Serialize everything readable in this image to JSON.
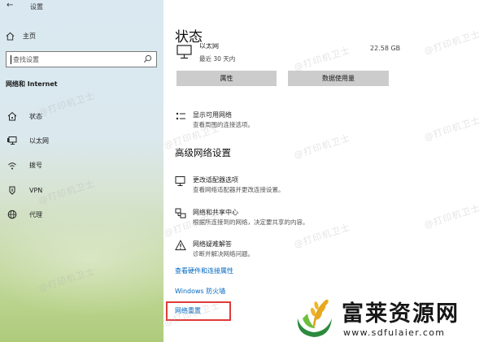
{
  "window": {
    "title": "设置"
  },
  "sidebar": {
    "home_label": "主页",
    "search_placeholder": "查找设置",
    "section_header": "网络和 Internet",
    "items": [
      {
        "label": "状态",
        "icon": "home-status-icon"
      },
      {
        "label": "以太网",
        "icon": "monitor-icon"
      },
      {
        "label": "拨号",
        "icon": "dialup-icon"
      },
      {
        "label": "VPN",
        "icon": "vpn-icon"
      },
      {
        "label": "代理",
        "icon": "globe-icon"
      }
    ]
  },
  "main": {
    "title": "状态",
    "ethernet": {
      "name": "以太网",
      "period": "最近 30 天内",
      "data_used": "22.58 GB"
    },
    "buttons": {
      "properties": "属性",
      "data_usage": "数据使用量"
    },
    "show_networks": {
      "title": "显示可用网络",
      "desc": "查看周围的连接选项。"
    },
    "advanced_header": "高级网络设置",
    "advanced_items": [
      {
        "title": "更改适配器选项",
        "desc": "查看网络适配器并更改连接设置。",
        "icon": "adapter-icon"
      },
      {
        "title": "网络和共享中心",
        "desc": "根据所连接到的网络，决定要共享的内容。",
        "icon": "sharing-center-icon"
      },
      {
        "title": "网络疑难解答",
        "desc": "诊断并解决网络问题。",
        "icon": "warning-icon"
      }
    ],
    "links": {
      "hardware_props": "查看硬件和连接属性",
      "firewall": "Windows 防火墙",
      "network_reset": "网络重置"
    }
  },
  "overlay": {
    "watermark": "@打印机卫士",
    "brand_name": "富莱资源网",
    "brand_url": "www.sdfulaier.com"
  },
  "colors": {
    "accent_link": "#0067c0",
    "highlight_box": "#e03a3a",
    "button_bg": "#cccccc"
  }
}
